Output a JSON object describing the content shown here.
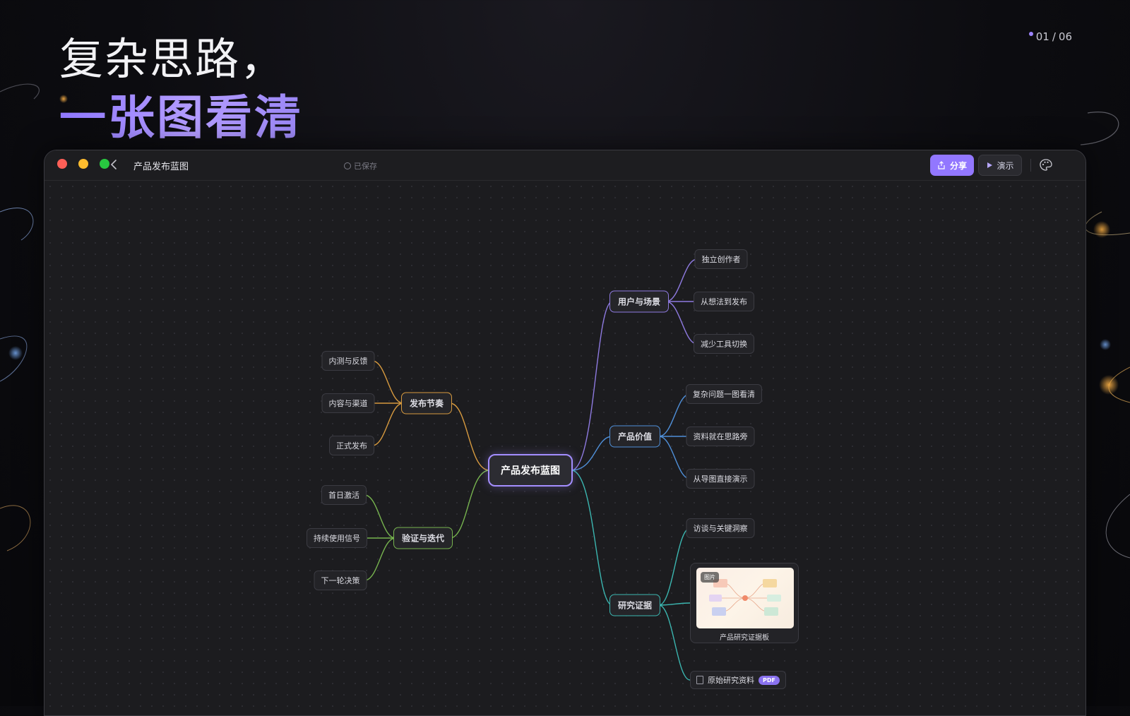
{
  "hero": {
    "line1": "复杂思路，",
    "line2": "一张图看清"
  },
  "pager": {
    "current": "01",
    "total": "06",
    "separator": "/"
  },
  "window": {
    "doc_title": "产品发布蓝图",
    "save_state": "已保存",
    "share_label": "分享",
    "present_label": "演示"
  },
  "mindmap": {
    "center": "产品发布蓝图",
    "right": [
      {
        "label": "用户与场景",
        "color": "#8e7ae0",
        "children": [
          "独立创作者",
          "从想法到发布",
          "减少工具切换"
        ]
      },
      {
        "label": "产品价值",
        "color": "#4f8fd8",
        "children": [
          "复杂问题一图看清",
          "资料就在思路旁",
          "从导图直接演示"
        ]
      },
      {
        "label": "研究证据",
        "color": "#3bb6b0",
        "children": [
          "访谈与关键洞察"
        ]
      }
    ],
    "left": [
      {
        "label": "发布节奏",
        "color": "#d79a3f",
        "children": [
          "内测与反馈",
          "内容与渠道",
          "正式发布"
        ]
      },
      {
        "label": "验证与迭代",
        "color": "#77b44f",
        "children": [
          "首日激活",
          "持续使用信号",
          "下一轮决策"
        ]
      }
    ],
    "image_card": {
      "badge": "图片",
      "caption": "产品研究证据板"
    },
    "file_node": {
      "label": "原始研究资料",
      "badge": "PDF"
    }
  },
  "colors": {
    "accent": "#9277ff",
    "center_border": "#a48eff",
    "traffic_red": "#fe5f57",
    "traffic_yellow": "#febc2e",
    "traffic_green": "#28c840"
  }
}
